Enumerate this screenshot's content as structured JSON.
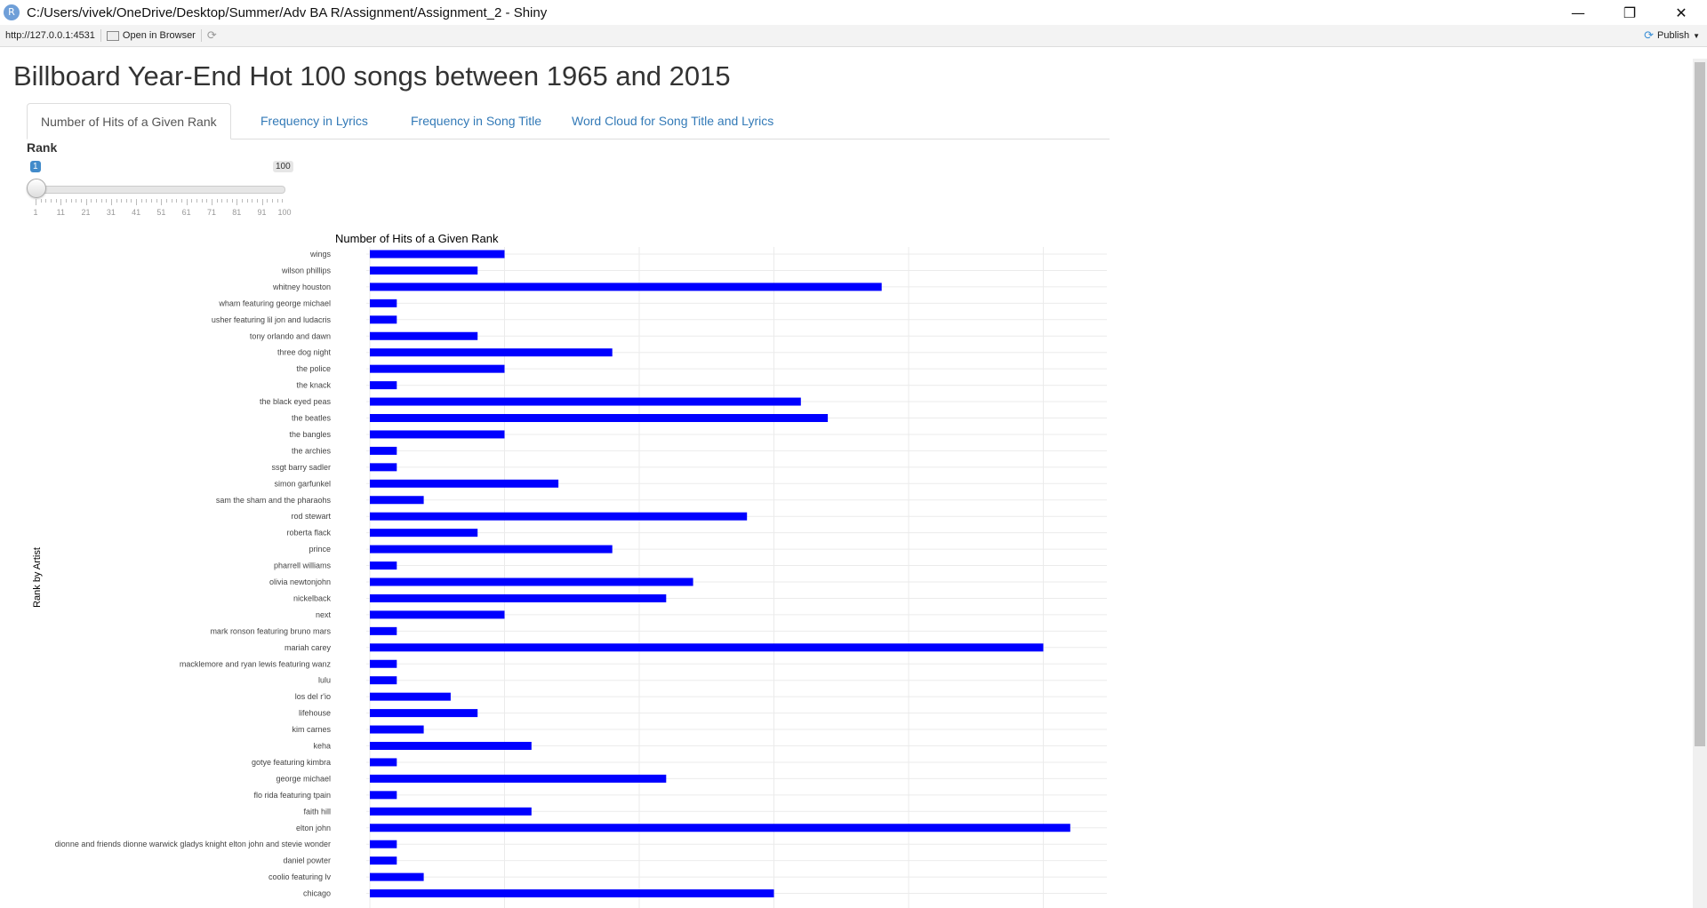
{
  "window": {
    "title": "C:/Users/vivek/OneDrive/Desktop/Summer/Adv BA R/Assignment/Assignment_2 - Shiny",
    "app_icon": "R",
    "controls": [
      "minimize-icon",
      "restore-icon",
      "close-icon"
    ]
  },
  "addressbar": {
    "url": "http://127.0.0.1:4531",
    "open_label": "Open in Browser",
    "publish_label": "Publish"
  },
  "page": {
    "title": "Billboard Year-End Hot 100 songs between 1965 and 2015"
  },
  "tabs": [
    {
      "label": "Number of Hits of a Given Rank",
      "active": true
    },
    {
      "label": "Frequency in Lyrics",
      "active": false
    },
    {
      "label": "Frequency in Song Title",
      "active": false
    },
    {
      "label": "Word Cloud for Song Title and Lyrics",
      "active": false
    }
  ],
  "slider": {
    "label": "Rank",
    "min": 1,
    "max": 100,
    "value": 1,
    "min_label": "1",
    "max_label": "100",
    "ticks": [
      "1",
      "11",
      "21",
      "31",
      "41",
      "51",
      "61",
      "71",
      "81",
      "91",
      "100"
    ]
  },
  "colors": {
    "bar": "#0000ff",
    "link": "#337ab7",
    "slider_value": "#428bca"
  },
  "chart_data": {
    "type": "bar",
    "orientation": "horizontal",
    "title": "Number of Hits of a Given Rank",
    "ylabel": "Rank by Artist",
    "xlabel": "",
    "grid": true,
    "categories": [
      "wings",
      "wilson phillips",
      "whitney houston",
      "wham featuring george michael",
      "usher featuring lil jon and ludacris",
      "tony orlando and dawn",
      "three dog night",
      "the police",
      "the knack",
      "the black eyed peas",
      "the beatles",
      "the bangles",
      "the archies",
      "ssgt barry sadler",
      "simon  garfunkel",
      "sam the sham and the pharaohs",
      "rod stewart",
      "roberta flack",
      "prince",
      "pharrell williams",
      "olivia newtonjohn",
      "nickelback",
      "next",
      "mark ronson featuring bruno mars",
      "mariah carey",
      "macklemore and ryan lewis featuring wanz",
      "lulu",
      "los del r'io",
      "lifehouse",
      "kim carnes",
      "keha",
      "gotye featuring kimbra",
      "george michael",
      "flo rida featuring tpain",
      "faith hill",
      "elton john",
      "dionne and friends dionne warwick gladys knight elton john and stevie wonder",
      "daniel powter",
      "coolio featuring lv",
      "chicago"
    ],
    "values": [
      5,
      4,
      19,
      1,
      1,
      4,
      9,
      5,
      1,
      16,
      17,
      5,
      1,
      1,
      7,
      2,
      14,
      4,
      9,
      1,
      12,
      11,
      5,
      1,
      25,
      1,
      1,
      3,
      4,
      2,
      6,
      1,
      11,
      1,
      6,
      26,
      1,
      1,
      2,
      15
    ]
  }
}
